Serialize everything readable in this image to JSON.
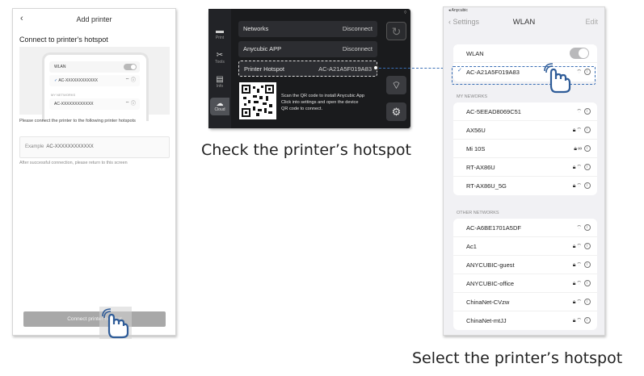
{
  "phone_left": {
    "back_icon": "chevron-left",
    "title": "Add printer",
    "subtitle": "Connect to printer's hotspot",
    "illustration": {
      "wlan_label": "WLAN",
      "selected_network": "AC-XXXXXXXXXXXX",
      "section_label": "MY NETWORKS",
      "network_item": "AC-XXXXXXXXXXXX"
    },
    "instruction": "Please connect the printer to the following printer hotspots",
    "example_label": "Example",
    "example_value": "AC-XXXXXXXXXXXX",
    "after_note": "After successful connection, please return to this screen",
    "connect_button": "Connect printer hotspot"
  },
  "printer_screen": {
    "sidebar": [
      {
        "label": "Print",
        "icon": "printer-icon"
      },
      {
        "label": "Tools",
        "icon": "tools-icon"
      },
      {
        "label": "Info",
        "icon": "info-icon"
      },
      {
        "label": "Cloud",
        "icon": "cloud-icon"
      }
    ],
    "rows": [
      {
        "label": "Networks",
        "value": "Disconnect"
      },
      {
        "label": "Anycubic APP",
        "value": "Disconnect"
      },
      {
        "label": "Printer Hotspot",
        "value": "AC-A21A5F019A83"
      }
    ],
    "qr_text": [
      "Scan the QR code to install Anycubic App",
      "Click into settings and open the device",
      "QR code to connect."
    ]
  },
  "caption_center": "Check the printer’s hotspot",
  "caption_right": "Select the printer’s hotspot",
  "phone_right": {
    "status_carrier": "◂ Anycubic",
    "back_label": "Settings",
    "title": "WLAN",
    "edit_label": "Edit",
    "wlan_label": "WLAN",
    "connected_network": "AC-A21A5F019A83",
    "my_networks_label": "MY NEWORKS",
    "my_networks": [
      {
        "name": "AC-5EEAD8069C51",
        "locked": false
      },
      {
        "name": "AX56U",
        "locked": true
      },
      {
        "name": "Mi 10S",
        "locked": true
      },
      {
        "name": "RT-AX86U",
        "locked": true
      },
      {
        "name": "RT-AX86U_5G",
        "locked": true
      }
    ],
    "other_networks_label": "OTHER NETWORKS",
    "other_networks": [
      {
        "name": "AC-A6BE1701A5DF",
        "locked": false
      },
      {
        "name": "Ac1",
        "locked": true
      },
      {
        "name": "ANYCUBIC-guest",
        "locked": true
      },
      {
        "name": "ANYCUBIC-office",
        "locked": true
      },
      {
        "name": "ChinaNet-CVzw",
        "locked": true
      },
      {
        "name": "ChinaNet-mtJJ",
        "locked": true
      }
    ]
  },
  "colors": {
    "accent": "#3a6fb5",
    "printer_bg": "#1a1b1d"
  }
}
